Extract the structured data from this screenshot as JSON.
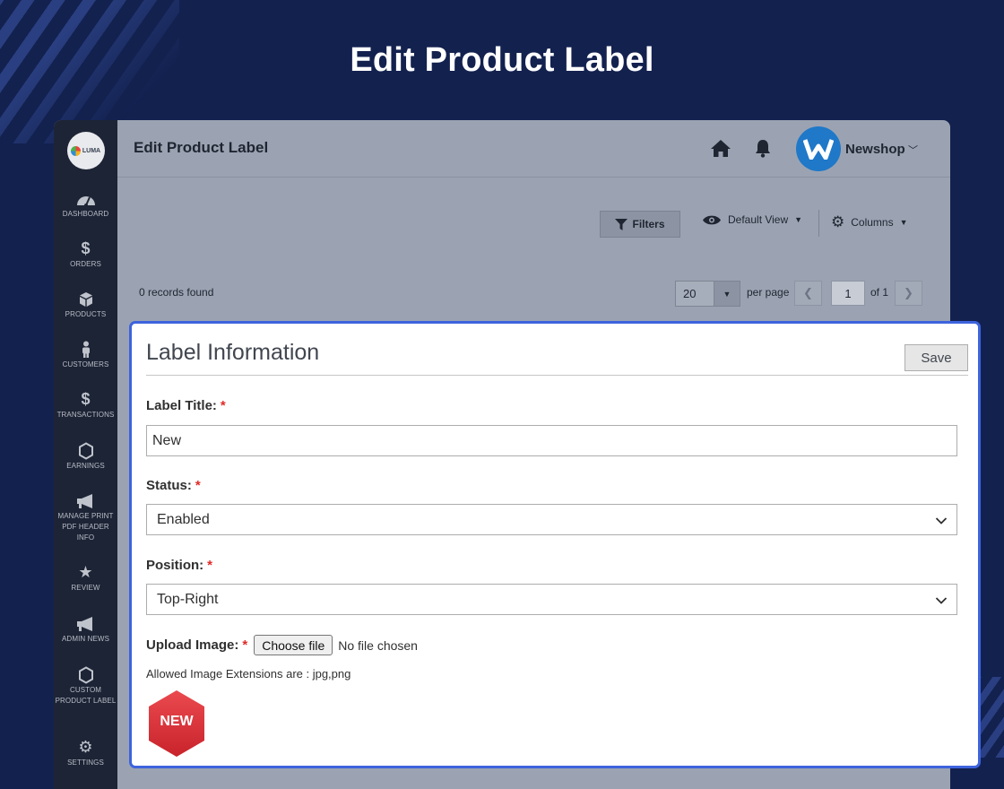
{
  "hero": {
    "title": "Edit Product Label"
  },
  "logo": {
    "text": "LUMA"
  },
  "sidebar": {
    "items": [
      {
        "label": "DASHBOARD"
      },
      {
        "label": "ORDERS"
      },
      {
        "label": "PRODUCTS"
      },
      {
        "label": "CUSTOMERS"
      },
      {
        "label": "TRANSACTIONS"
      },
      {
        "label": "EARNINGS"
      },
      {
        "label": "MANAGE PRINT PDF HEADER INFO"
      },
      {
        "label": "REVIEW"
      },
      {
        "label": "ADMIN NEWS"
      },
      {
        "label": "CUSTOM PRODUCT LABEL"
      },
      {
        "label": "SETTINGS"
      }
    ]
  },
  "header": {
    "title": "Edit Product Label",
    "user": "Newshop"
  },
  "grid": {
    "filters_label": "Filters",
    "view_label": "Default View",
    "columns_label": "Columns",
    "records": "0 records found",
    "per_page_value": "20",
    "per_page_label": "per page",
    "page_current": "1",
    "page_total": "of 1"
  },
  "modal": {
    "title": "Label Information",
    "save_label": "Save",
    "label_title_label": "Label Title:",
    "label_title_value": "New",
    "status_label": "Status:",
    "status_value": "Enabled",
    "position_label": "Position:",
    "position_value": "Top-Right",
    "upload_label": "Upload Image:",
    "choose_file": "Choose file",
    "no_file": "No file chosen",
    "hint": "Allowed Image Extensions are : jpg,png",
    "badge_text": "NEW",
    "required_mark": "*"
  },
  "colors": {
    "background": "#13214f",
    "sidebar": "#1d2435",
    "modal_border": "#3d63dd",
    "required": "#e02b27",
    "badge": "#e0343c",
    "avatar": "#1f78c8"
  }
}
